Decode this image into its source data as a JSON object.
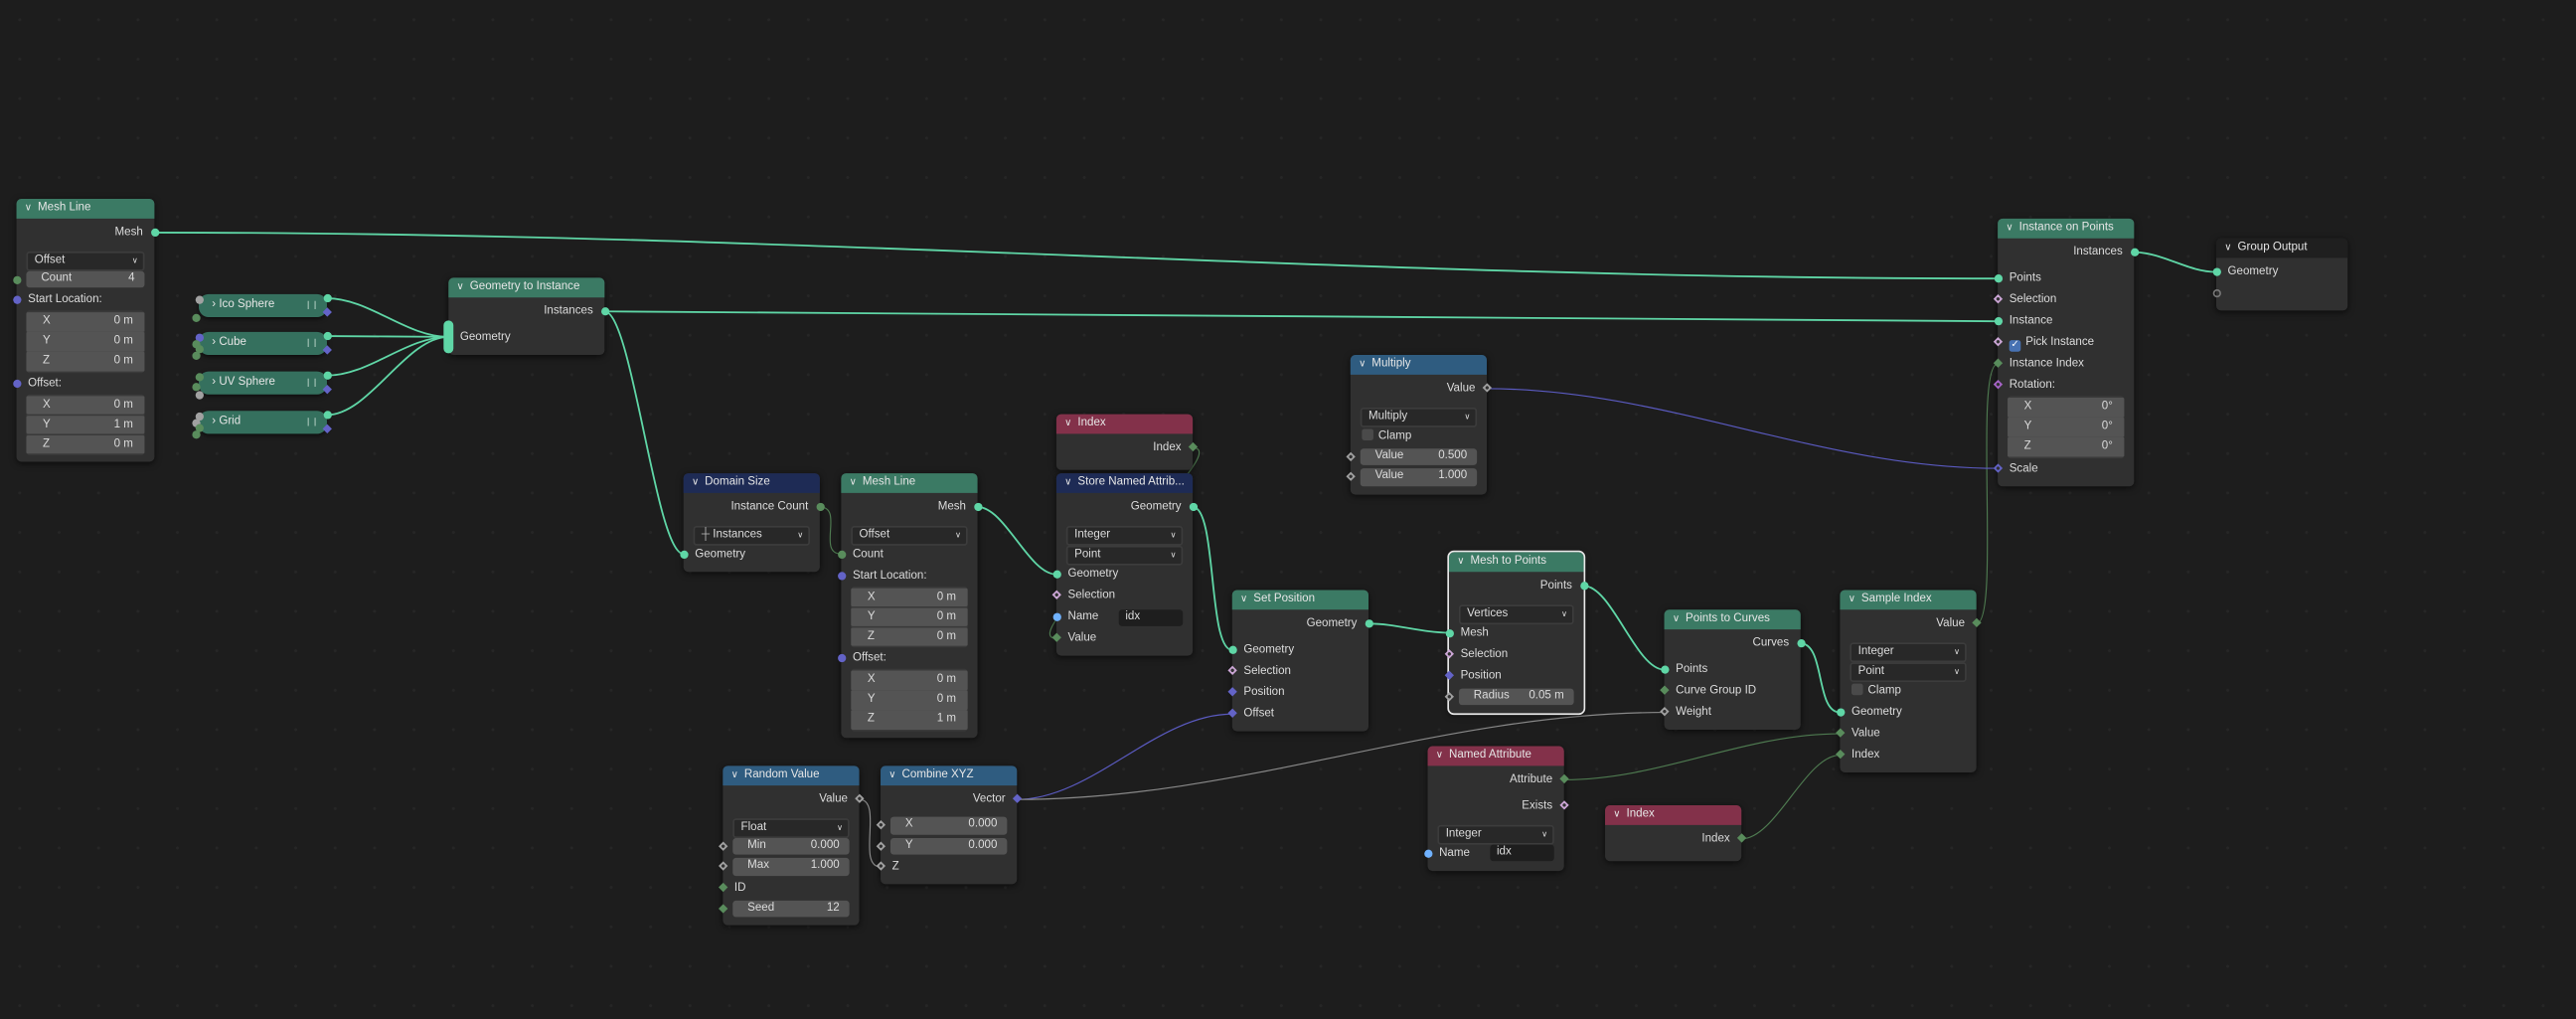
{
  "editor": "Geometry Nodes",
  "colors": {
    "geometry": "#3b7a64",
    "attribute": "#1e2b55",
    "converter": "#2f5c80",
    "input": "#83314a",
    "output": "#1f1f1f",
    "sockets": {
      "geo": "#5fd6a6",
      "str": "#70b2ff",
      "int": "#598c5c",
      "float": "#a1a1a1",
      "vec": "#6363c7",
      "bool": "#cca6d6",
      "rot": "#a663c7",
      "empty": "#4a4a4a"
    }
  },
  "nodes": [
    {
      "id": "mesh_line_1",
      "kind": "geometry",
      "title": "Mesh Line",
      "rows": [
        {
          "t": "out",
          "label": "Mesh",
          "sock": "geo"
        },
        {
          "t": "dd",
          "value": "Offset"
        },
        {
          "t": "fld",
          "label": "Count",
          "value": "4",
          "sock": "int"
        },
        {
          "t": "in",
          "label": "Start Location:",
          "sock": "vec"
        },
        {
          "t": "vec",
          "items": [
            {
              "label": "X",
              "value": "0 m"
            },
            {
              "label": "Y",
              "value": "0 m"
            },
            {
              "label": "Z",
              "value": "0 m"
            }
          ]
        },
        {
          "t": "in",
          "label": "Offset:",
          "sock": "vec"
        },
        {
          "t": "vec",
          "items": [
            {
              "label": "X",
              "value": "0 m"
            },
            {
              "label": "Y",
              "value": "1 m"
            },
            {
              "label": "Z",
              "value": "0 m"
            }
          ]
        }
      ]
    },
    {
      "id": "geo_to_instance",
      "kind": "geometry",
      "title": "Geometry to Instance",
      "rows": [
        {
          "t": "out",
          "label": "Instances",
          "sock": "geo"
        },
        {
          "t": "in",
          "label": "Geometry",
          "sock": "geo",
          "multi": true
        }
      ]
    },
    {
      "id": "domain_size",
      "kind": "attribute",
      "title": "Domain Size",
      "rows": [
        {
          "t": "out",
          "label": "Instance Count",
          "sock": "int"
        },
        {
          "t": "dd",
          "value": "Instances",
          "icon": true
        },
        {
          "t": "in",
          "label": "Geometry",
          "sock": "geo"
        }
      ]
    },
    {
      "id": "mesh_line_2",
      "kind": "geometry",
      "title": "Mesh Line",
      "rows": [
        {
          "t": "out",
          "label": "Mesh",
          "sock": "geo"
        },
        {
          "t": "dd",
          "value": "Offset"
        },
        {
          "t": "in",
          "label": "Count",
          "sock": "int"
        },
        {
          "t": "in",
          "label": "Start Location:",
          "sock": "vec"
        },
        {
          "t": "vec",
          "items": [
            {
              "label": "X",
              "value": "0 m"
            },
            {
              "label": "Y",
              "value": "0 m"
            },
            {
              "label": "Z",
              "value": "0 m"
            }
          ]
        },
        {
          "t": "in",
          "label": "Offset:",
          "sock": "vec"
        },
        {
          "t": "vec",
          "items": [
            {
              "label": "X",
              "value": "0 m"
            },
            {
              "label": "Y",
              "value": "0 m"
            },
            {
              "label": "Z",
              "value": "1 m"
            }
          ]
        }
      ]
    },
    {
      "id": "index_1",
      "kind": "input",
      "title": "Index",
      "rows": [
        {
          "t": "out",
          "label": "Index",
          "sock": "intd"
        }
      ]
    },
    {
      "id": "store_named",
      "kind": "attribute",
      "title": "Store Named Attrib...",
      "rows": [
        {
          "t": "out",
          "label": "Geometry",
          "sock": "geo"
        },
        {
          "t": "dd",
          "value": "Integer"
        },
        {
          "t": "dd",
          "value": "Point"
        },
        {
          "t": "in",
          "label": "Geometry",
          "sock": "geo"
        },
        {
          "t": "in",
          "label": "Selection",
          "sock": "boold"
        },
        {
          "t": "name",
          "label": "Name",
          "value": "idx",
          "sock": "str"
        },
        {
          "t": "in",
          "label": "Value",
          "sock": "intd"
        }
      ]
    },
    {
      "id": "set_position",
      "kind": "geometry",
      "title": "Set Position",
      "rows": [
        {
          "t": "out",
          "label": "Geometry",
          "sock": "geo"
        },
        {
          "t": "in",
          "label": "Geometry",
          "sock": "geo"
        },
        {
          "t": "in",
          "label": "Selection",
          "sock": "boold"
        },
        {
          "t": "in",
          "label": "Position",
          "sock": "vecd"
        },
        {
          "t": "in",
          "label": "Offset",
          "sock": "vecd"
        }
      ]
    },
    {
      "id": "multiply",
      "kind": "converter",
      "title": "Multiply",
      "rows": [
        {
          "t": "out",
          "label": "Value",
          "sock": "floatd"
        },
        {
          "t": "dd",
          "value": "Multiply"
        },
        {
          "t": "check",
          "label": "Clamp",
          "checked": false
        },
        {
          "t": "fld",
          "label": "Value",
          "value": "0.500",
          "sock": "floatd"
        },
        {
          "t": "fld",
          "label": "Value",
          "value": "1.000",
          "sock": "floatd"
        }
      ]
    },
    {
      "id": "mesh_to_points",
      "kind": "geometry",
      "title": "Mesh to Points",
      "selected": true,
      "rows": [
        {
          "t": "out",
          "label": "Points",
          "sock": "geo"
        },
        {
          "t": "dd",
          "value": "Vertices"
        },
        {
          "t": "in",
          "label": "Mesh",
          "sock": "geo"
        },
        {
          "t": "in",
          "label": "Selection",
          "sock": "boold"
        },
        {
          "t": "in",
          "label": "Position",
          "sock": "vecd"
        },
        {
          "t": "fld",
          "label": "Radius",
          "value": "0.05 m",
          "sock": "floatd"
        }
      ]
    },
    {
      "id": "points_to_curves",
      "kind": "geometry",
      "title": "Points to Curves",
      "rows": [
        {
          "t": "out",
          "label": "Curves",
          "sock": "geo"
        },
        {
          "t": "in",
          "label": "Points",
          "sock": "geo"
        },
        {
          "t": "in",
          "label": "Curve Group ID",
          "sock": "intd"
        },
        {
          "t": "in",
          "label": "Weight",
          "sock": "floatd"
        }
      ]
    },
    {
      "id": "sample_index",
      "kind": "geometry",
      "title": "Sample Index",
      "rows": [
        {
          "t": "out",
          "label": "Value",
          "sock": "intd"
        },
        {
          "t": "dd",
          "value": "Integer"
        },
        {
          "t": "dd",
          "value": "Point"
        },
        {
          "t": "check",
          "label": "Clamp",
          "checked": false
        },
        {
          "t": "in",
          "label": "Geometry",
          "sock": "geo"
        },
        {
          "t": "in",
          "label": "Value",
          "sock": "intd"
        },
        {
          "t": "in",
          "label": "Index",
          "sock": "intd"
        }
      ]
    },
    {
      "id": "instance_on_points",
      "kind": "geometry",
      "title": "Instance on Points",
      "rows": [
        {
          "t": "out",
          "label": "Instances",
          "sock": "geo"
        },
        {
          "t": "in",
          "label": "Points",
          "sock": "geo"
        },
        {
          "t": "in",
          "label": "Selection",
          "sock": "boold"
        },
        {
          "t": "in",
          "label": "Instance",
          "sock": "geo"
        },
        {
          "t": "check",
          "label": "Pick Instance",
          "checked": true,
          "sock": "boold"
        },
        {
          "t": "in",
          "label": "Instance Index",
          "sock": "intd"
        },
        {
          "t": "in",
          "label": "Rotation:",
          "sock": "rotd"
        },
        {
          "t": "vec",
          "items": [
            {
              "label": "X",
              "value": "0°"
            },
            {
              "label": "Y",
              "value": "0°"
            },
            {
              "label": "Z",
              "value": "0°"
            }
          ]
        },
        {
          "t": "in",
          "label": "Scale",
          "sock": "vecd"
        }
      ]
    },
    {
      "id": "group_output",
      "kind": "output",
      "title": "Group Output",
      "rows": [
        {
          "t": "in",
          "label": "Geometry",
          "sock": "geo"
        },
        {
          "t": "in",
          "label": "",
          "sock": "empty"
        }
      ]
    },
    {
      "id": "random_value",
      "kind": "converter",
      "title": "Random Value",
      "rows": [
        {
          "t": "out",
          "label": "Value",
          "sock": "floatd"
        },
        {
          "t": "dd",
          "value": "Float"
        },
        {
          "t": "fld",
          "label": "Min",
          "value": "0.000",
          "sock": "floatd"
        },
        {
          "t": "fld",
          "label": "Max",
          "value": "1.000",
          "sock": "floatd"
        },
        {
          "t": "in",
          "label": "ID",
          "sock": "intd"
        },
        {
          "t": "fld",
          "label": "Seed",
          "value": "12",
          "sock": "intd"
        }
      ]
    },
    {
      "id": "combine_xyz",
      "kind": "converter",
      "title": "Combine XYZ",
      "rows": [
        {
          "t": "out",
          "label": "Vector",
          "sock": "vecd"
        },
        {
          "t": "fld",
          "label": "X",
          "value": "0.000",
          "sock": "floatd"
        },
        {
          "t": "fld",
          "label": "Y",
          "value": "0.000",
          "sock": "floatd"
        },
        {
          "t": "in",
          "label": "Z",
          "sock": "floatd"
        }
      ]
    },
    {
      "id": "named_attribute",
      "kind": "input",
      "title": "Named Attribute",
      "rows": [
        {
          "t": "out",
          "label": "Attribute",
          "sock": "intd"
        },
        {
          "t": "out",
          "label": "Exists",
          "sock": "boold"
        },
        {
          "t": "dd",
          "value": "Integer"
        },
        {
          "t": "name",
          "label": "Name",
          "value": "idx",
          "sock": "str"
        }
      ]
    },
    {
      "id": "index_2",
      "kind": "input",
      "title": "Index",
      "rows": [
        {
          "t": "out",
          "label": "Index",
          "sock": "intd"
        }
      ]
    }
  ],
  "group_nodes": [
    {
      "id": "ico_sphere",
      "title": "Ico Sphere",
      "inputs": [
        "float",
        "int"
      ]
    },
    {
      "id": "cube",
      "title": "Cube",
      "inputs": [
        "vec",
        "int",
        "int",
        "int"
      ]
    },
    {
      "id": "uv_sphere",
      "title": "UV Sphere",
      "inputs": [
        "int",
        "int",
        "float"
      ]
    },
    {
      "id": "grid",
      "title": "Grid",
      "inputs": [
        "float",
        "float",
        "int",
        "int"
      ]
    }
  ],
  "links": [
    {
      "from": "mesh_line_1/out/Mesh",
      "to": "instance_on_points/in/Points",
      "type": "geo"
    },
    {
      "from": "ico_sphere/out/Geometry",
      "to": "geo_to_instance/in/Geometry",
      "type": "geo"
    },
    {
      "from": "cube/out/Geometry",
      "to": "geo_to_instance/in/Geometry",
      "type": "geo"
    },
    {
      "from": "uv_sphere/out/Geometry",
      "to": "geo_to_instance/in/Geometry",
      "type": "geo"
    },
    {
      "from": "grid/out/Geometry",
      "to": "geo_to_instance/in/Geometry",
      "type": "geo"
    },
    {
      "from": "geo_to_instance/out/Instances",
      "to": "instance_on_points/in/Instance",
      "type": "geo"
    },
    {
      "from": "geo_to_instance/out/Instances",
      "to": "domain_size/in/Geometry",
      "type": "geo"
    },
    {
      "from": "domain_size/out/Instance Count",
      "to": "mesh_line_2/in/Count",
      "type": "int"
    },
    {
      "from": "mesh_line_2/out/Mesh",
      "to": "store_named/in/Geometry",
      "type": "geo"
    },
    {
      "from": "index_1/out/Index",
      "to": "store_named/in/Value",
      "type": "int"
    },
    {
      "from": "store_named/out/Geometry",
      "to": "set_position/in/Geometry",
      "type": "geo"
    },
    {
      "from": "set_position/out/Geometry",
      "to": "mesh_to_points/in/Mesh",
      "type": "geo"
    },
    {
      "from": "mesh_to_points/out/Points",
      "to": "points_to_curves/in/Points",
      "type": "geo"
    },
    {
      "from": "points_to_curves/out/Curves",
      "to": "sample_index/in/Geometry",
      "type": "geo"
    },
    {
      "from": "sample_index/out/Value",
      "to": "instance_on_points/in/Instance Index",
      "type": "int"
    },
    {
      "from": "multiply/out/Value",
      "to": "instance_on_points/in/Scale",
      "type": "vec"
    },
    {
      "from": "random_value/out/Value",
      "to": "combine_xyz/in/Z",
      "type": "float"
    },
    {
      "from": "combine_xyz/out/Vector",
      "to": "set_position/in/Offset",
      "type": "vec"
    },
    {
      "from": "combine_xyz/out/Vector",
      "to": "points_to_curves/in/Weight",
      "type": "float"
    },
    {
      "from": "named_attribute/out/Attribute",
      "to": "sample_index/in/Value",
      "type": "int"
    },
    {
      "from": "index_2/out/Index",
      "to": "sample_index/in/Index",
      "type": "int"
    },
    {
      "from": "instance_on_points/out/Instances",
      "to": "group_output/in/Geometry",
      "type": "geo"
    }
  ]
}
